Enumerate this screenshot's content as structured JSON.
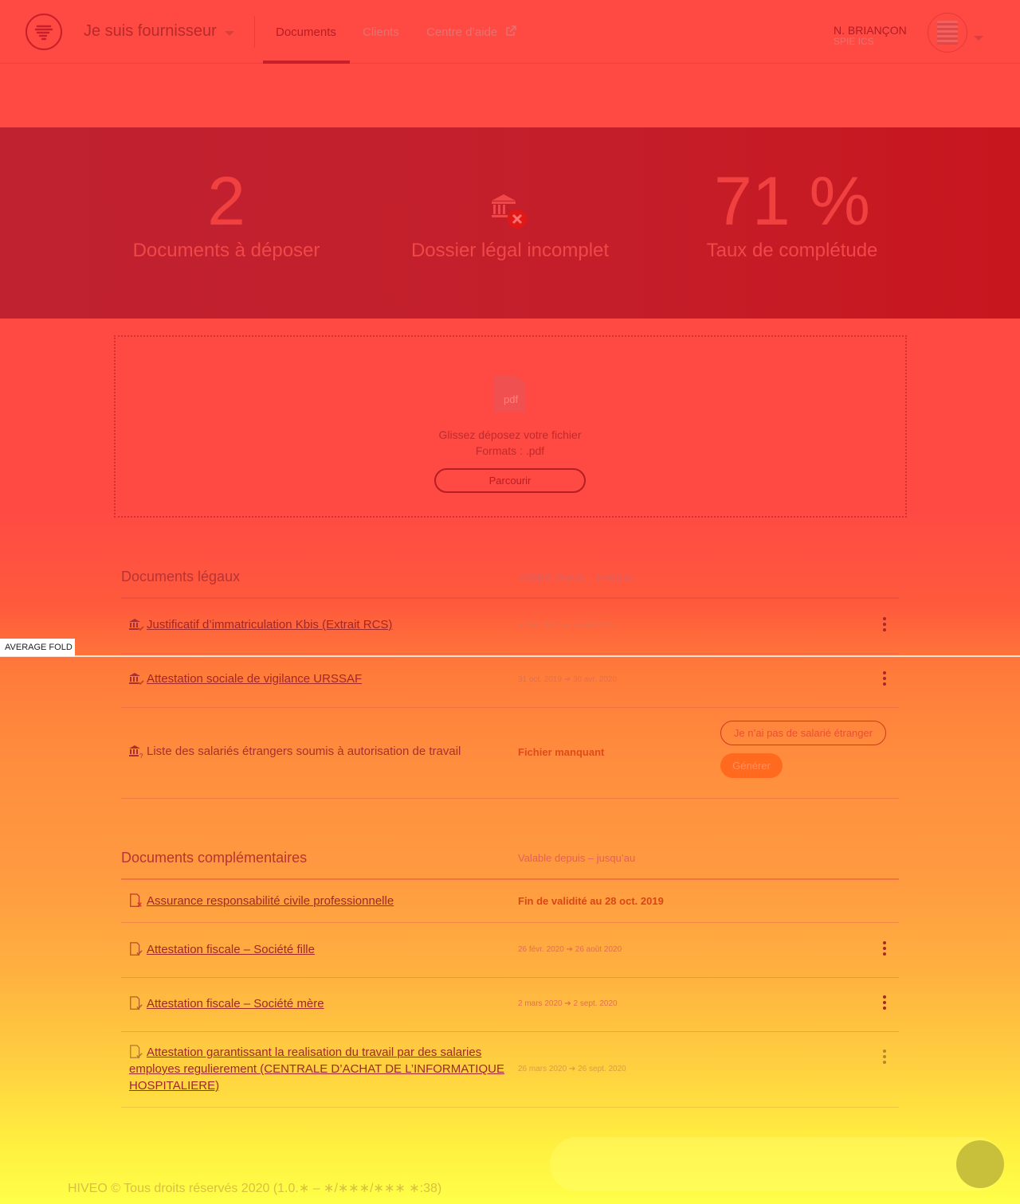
{
  "header": {
    "role_label": "Je suis fournisseur",
    "tabs": [
      {
        "label": "Documents",
        "active": true
      },
      {
        "label": "Clients",
        "active": false
      },
      {
        "label": "Centre d’aide",
        "active": false,
        "external": true
      }
    ],
    "user": {
      "name": "N. BRIANÇON",
      "org": "SPIE ICS"
    }
  },
  "stats": {
    "docs_count": "2",
    "docs_label": "Documents à déposer",
    "legal_label": "Dossier légal incomplet",
    "completion": "71 %",
    "completion_label": "Taux de complétude"
  },
  "dropzone": {
    "icon_text": "pdf",
    "instruction": "Glissez déposez votre fichier",
    "formats": "Formats : .pdf",
    "browse_label": "Parcourir"
  },
  "legal_section": {
    "title": "Documents légaux",
    "column_header": "Valable depuis – jusqu’au",
    "rows": [
      {
        "label": "Justificatif d’immatriculation Kbis (Extrait RCS)",
        "from": "5 févr. 2020",
        "to": "5 août 2020"
      },
      {
        "label": "Attestation sociale de vigilance URSSAF",
        "from": "31 oct. 2019",
        "to": "30 avr. 2020"
      },
      {
        "label": "Liste des salariés étrangers soumis à autorisation de travail",
        "status": "Fichier manquant",
        "no_foreign_label": "Je n’ai pas de salarié étranger",
        "generate_label": "Générer"
      }
    ]
  },
  "complementary_section": {
    "title": "Documents complémentaires",
    "column_header": "Valable depuis – jusqu’au",
    "rows": [
      {
        "label": "Assurance responsabilité civile professionnelle",
        "status": "Fin de validité au 28 oct. 2019"
      },
      {
        "label": "Attestation fiscale – Société fille",
        "from": "26 févr. 2020",
        "to": "26 août 2020"
      },
      {
        "label": "Attestation fiscale – Société mère",
        "from": "2 mars 2020",
        "to": "2 sept. 2020"
      },
      {
        "label_line1": "Attestation garantissant la realisation du travail par des salaries",
        "label_line2": "employes regulierement (CENTRALE D’ACHAT DE L’INFORMATIQUE",
        "label_line3": "HOSPITALIERE)",
        "from": "26 mars 2020",
        "to": "26 sept. 2020"
      }
    ]
  },
  "fold_label": "AVERAGE FOLD",
  "footer": "HIVEO © Tous droits réservés 2020 (1.0.∗ – ∗/∗∗∗/∗∗∗ ∗:38)",
  "colors": {
    "brand_red": "#c8202a",
    "warning": "#e85030"
  }
}
